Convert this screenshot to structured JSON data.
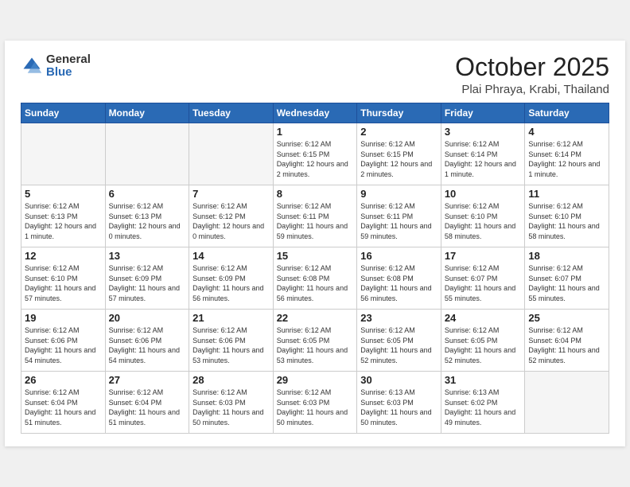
{
  "header": {
    "logo_general": "General",
    "logo_blue": "Blue",
    "month_title": "October 2025",
    "location": "Plai Phraya, Krabi, Thailand"
  },
  "weekdays": [
    "Sunday",
    "Monday",
    "Tuesday",
    "Wednesday",
    "Thursday",
    "Friday",
    "Saturday"
  ],
  "weeks": [
    [
      {
        "day": "",
        "empty": true
      },
      {
        "day": "",
        "empty": true
      },
      {
        "day": "",
        "empty": true
      },
      {
        "day": "1",
        "sunrise": "Sunrise: 6:12 AM",
        "sunset": "Sunset: 6:15 PM",
        "daylight": "Daylight: 12 hours and 2 minutes."
      },
      {
        "day": "2",
        "sunrise": "Sunrise: 6:12 AM",
        "sunset": "Sunset: 6:15 PM",
        "daylight": "Daylight: 12 hours and 2 minutes."
      },
      {
        "day": "3",
        "sunrise": "Sunrise: 6:12 AM",
        "sunset": "Sunset: 6:14 PM",
        "daylight": "Daylight: 12 hours and 1 minute."
      },
      {
        "day": "4",
        "sunrise": "Sunrise: 6:12 AM",
        "sunset": "Sunset: 6:14 PM",
        "daylight": "Daylight: 12 hours and 1 minute."
      }
    ],
    [
      {
        "day": "5",
        "sunrise": "Sunrise: 6:12 AM",
        "sunset": "Sunset: 6:13 PM",
        "daylight": "Daylight: 12 hours and 1 minute."
      },
      {
        "day": "6",
        "sunrise": "Sunrise: 6:12 AM",
        "sunset": "Sunset: 6:13 PM",
        "daylight": "Daylight: 12 hours and 0 minutes."
      },
      {
        "day": "7",
        "sunrise": "Sunrise: 6:12 AM",
        "sunset": "Sunset: 6:12 PM",
        "daylight": "Daylight: 12 hours and 0 minutes."
      },
      {
        "day": "8",
        "sunrise": "Sunrise: 6:12 AM",
        "sunset": "Sunset: 6:11 PM",
        "daylight": "Daylight: 11 hours and 59 minutes."
      },
      {
        "day": "9",
        "sunrise": "Sunrise: 6:12 AM",
        "sunset": "Sunset: 6:11 PM",
        "daylight": "Daylight: 11 hours and 59 minutes."
      },
      {
        "day": "10",
        "sunrise": "Sunrise: 6:12 AM",
        "sunset": "Sunset: 6:10 PM",
        "daylight": "Daylight: 11 hours and 58 minutes."
      },
      {
        "day": "11",
        "sunrise": "Sunrise: 6:12 AM",
        "sunset": "Sunset: 6:10 PM",
        "daylight": "Daylight: 11 hours and 58 minutes."
      }
    ],
    [
      {
        "day": "12",
        "sunrise": "Sunrise: 6:12 AM",
        "sunset": "Sunset: 6:10 PM",
        "daylight": "Daylight: 11 hours and 57 minutes."
      },
      {
        "day": "13",
        "sunrise": "Sunrise: 6:12 AM",
        "sunset": "Sunset: 6:09 PM",
        "daylight": "Daylight: 11 hours and 57 minutes."
      },
      {
        "day": "14",
        "sunrise": "Sunrise: 6:12 AM",
        "sunset": "Sunset: 6:09 PM",
        "daylight": "Daylight: 11 hours and 56 minutes."
      },
      {
        "day": "15",
        "sunrise": "Sunrise: 6:12 AM",
        "sunset": "Sunset: 6:08 PM",
        "daylight": "Daylight: 11 hours and 56 minutes."
      },
      {
        "day": "16",
        "sunrise": "Sunrise: 6:12 AM",
        "sunset": "Sunset: 6:08 PM",
        "daylight": "Daylight: 11 hours and 56 minutes."
      },
      {
        "day": "17",
        "sunrise": "Sunrise: 6:12 AM",
        "sunset": "Sunset: 6:07 PM",
        "daylight": "Daylight: 11 hours and 55 minutes."
      },
      {
        "day": "18",
        "sunrise": "Sunrise: 6:12 AM",
        "sunset": "Sunset: 6:07 PM",
        "daylight": "Daylight: 11 hours and 55 minutes."
      }
    ],
    [
      {
        "day": "19",
        "sunrise": "Sunrise: 6:12 AM",
        "sunset": "Sunset: 6:06 PM",
        "daylight": "Daylight: 11 hours and 54 minutes."
      },
      {
        "day": "20",
        "sunrise": "Sunrise: 6:12 AM",
        "sunset": "Sunset: 6:06 PM",
        "daylight": "Daylight: 11 hours and 54 minutes."
      },
      {
        "day": "21",
        "sunrise": "Sunrise: 6:12 AM",
        "sunset": "Sunset: 6:06 PM",
        "daylight": "Daylight: 11 hours and 53 minutes."
      },
      {
        "day": "22",
        "sunrise": "Sunrise: 6:12 AM",
        "sunset": "Sunset: 6:05 PM",
        "daylight": "Daylight: 11 hours and 53 minutes."
      },
      {
        "day": "23",
        "sunrise": "Sunrise: 6:12 AM",
        "sunset": "Sunset: 6:05 PM",
        "daylight": "Daylight: 11 hours and 52 minutes."
      },
      {
        "day": "24",
        "sunrise": "Sunrise: 6:12 AM",
        "sunset": "Sunset: 6:05 PM",
        "daylight": "Daylight: 11 hours and 52 minutes."
      },
      {
        "day": "25",
        "sunrise": "Sunrise: 6:12 AM",
        "sunset": "Sunset: 6:04 PM",
        "daylight": "Daylight: 11 hours and 52 minutes."
      }
    ],
    [
      {
        "day": "26",
        "sunrise": "Sunrise: 6:12 AM",
        "sunset": "Sunset: 6:04 PM",
        "daylight": "Daylight: 11 hours and 51 minutes."
      },
      {
        "day": "27",
        "sunrise": "Sunrise: 6:12 AM",
        "sunset": "Sunset: 6:04 PM",
        "daylight": "Daylight: 11 hours and 51 minutes."
      },
      {
        "day": "28",
        "sunrise": "Sunrise: 6:12 AM",
        "sunset": "Sunset: 6:03 PM",
        "daylight": "Daylight: 11 hours and 50 minutes."
      },
      {
        "day": "29",
        "sunrise": "Sunrise: 6:12 AM",
        "sunset": "Sunset: 6:03 PM",
        "daylight": "Daylight: 11 hours and 50 minutes."
      },
      {
        "day": "30",
        "sunrise": "Sunrise: 6:13 AM",
        "sunset": "Sunset: 6:03 PM",
        "daylight": "Daylight: 11 hours and 50 minutes."
      },
      {
        "day": "31",
        "sunrise": "Sunrise: 6:13 AM",
        "sunset": "Sunset: 6:02 PM",
        "daylight": "Daylight: 11 hours and 49 minutes."
      },
      {
        "day": "",
        "empty": true
      }
    ]
  ]
}
